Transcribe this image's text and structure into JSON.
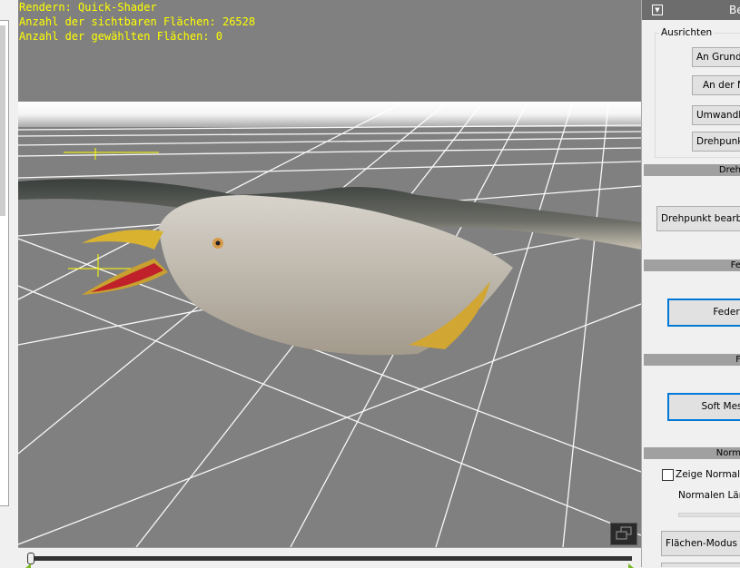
{
  "hud": {
    "render": "Rendern: Quick-Shader",
    "visible_faces": "Anzahl der sichtbaren Flächen: 26528",
    "selected_faces": "Anzahl der gewählten Flächen: 0"
  },
  "panel": {
    "title": "Be",
    "align_group": "Ausrichten",
    "align_buttons": [
      "An Grundfl",
      "An der M",
      "Umwandlun",
      "Drehpunkt"
    ],
    "sections": {
      "pivot": "Dreh",
      "feather": "Fe",
      "soft": "F",
      "normals": "Norm"
    },
    "pivot_edit": "Drehpunkt bearbei",
    "feather_button": "Feder",
    "soft_button": "Soft Mes",
    "show_normals": "Zeige Normale",
    "show_normals_checked": false,
    "normal_length": "Normalen Läng",
    "face_mode": "Flächen-Modus ur"
  },
  "timeline": {
    "position": 0
  }
}
